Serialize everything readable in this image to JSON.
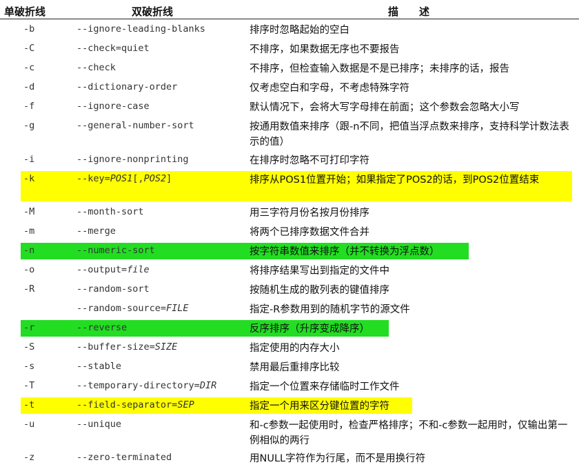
{
  "header": {
    "short": "单破折线",
    "long": "双破折线",
    "desc": "描　　述"
  },
  "rows": [
    {
      "s": "-b",
      "l": "--ignore-leading-blanks",
      "d": "排序时忽略起始的空白"
    },
    {
      "s": "-C",
      "l": "--check=quiet",
      "d": "不排序，如果数据无序也不要报告"
    },
    {
      "s": "-c",
      "l": "--check",
      "d": "不排序，但检查输入数据是不是已排序；未排序的话，报告"
    },
    {
      "s": "-d",
      "l": "--dictionary-order",
      "d": "仅考虑空白和字母，不考虑特殊字符"
    },
    {
      "s": "-f",
      "l": "--ignore-case",
      "d": "默认情况下，会将大写字母排在前面；这个参数会忽略大小写"
    },
    {
      "s": "-g",
      "l": "--general-number-sort",
      "d": "按通用数值来排序（跟-n不同，把值当浮点数来排序，支持科学计数法表示的值）"
    },
    {
      "s": "-i",
      "l": "--ignore-nonprinting",
      "d": "在排序时忽略不可打印字符"
    },
    {
      "s": "-k",
      "l": "--key=POS1[,POS2]",
      "d": "排序从POS1位置开始；如果指定了POS2的话，到POS2位置结束",
      "hl": "yellow"
    },
    {
      "s": "-M",
      "l": "--month-sort",
      "d": "用三字符月份名按月份排序"
    },
    {
      "s": "-m",
      "l": "--merge",
      "d": "将两个已排序数据文件合并"
    },
    {
      "s": "-n",
      "l": "--numeric-sort",
      "d": "按字符串数值来排序（并不转换为浮点数）",
      "hl": "green"
    },
    {
      "s": "-o",
      "l": "--output=file",
      "d": "将排序结果写出到指定的文件中"
    },
    {
      "s": "-R",
      "l": "--random-sort",
      "d": "按随机生成的散列表的键值排序"
    },
    {
      "s": "",
      "l": "--random-source=FILE",
      "d": "指定-R参数用到的随机字节的源文件"
    },
    {
      "s": "-r",
      "l": "--reverse",
      "d": "反序排序（升序变成降序）",
      "hl": "green"
    },
    {
      "s": "-S",
      "l": "--buffer-size=SIZE",
      "d": "指定使用的内存大小"
    },
    {
      "s": "-s",
      "l": "--stable",
      "d": "禁用最后重排序比较"
    },
    {
      "s": "-T",
      "l": "--temporary-directory=DIR",
      "d": "指定一个位置来存储临时工作文件"
    },
    {
      "s": "-t",
      "l": "--field-separator=SEP",
      "d": "指定一个用来区分键位置的字符",
      "hl": "yellow"
    },
    {
      "s": "-u",
      "l": "--unique",
      "d": "和-c参数一起使用时，检查严格排序；不和-c参数一起用时，仅输出第一例相似的两行"
    },
    {
      "s": "-z",
      "l": "--zero-terminated",
      "d": "用NULL字符作为行尾，而不是用换行符"
    }
  ],
  "highlight_colors": {
    "yellow": "#ffff00",
    "green": "#22dd22"
  }
}
